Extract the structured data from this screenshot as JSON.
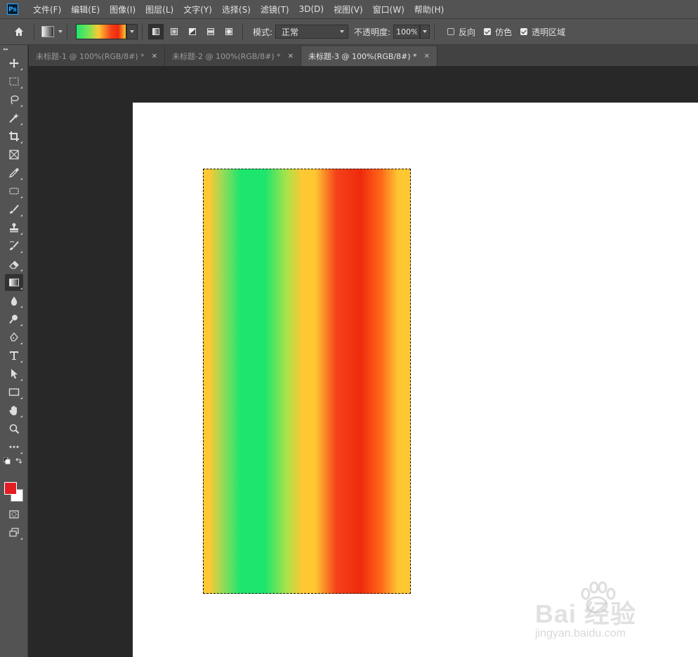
{
  "menu": {
    "logo": "Ps",
    "items": [
      "文件(F)",
      "编辑(E)",
      "图像(I)",
      "图层(L)",
      "文字(Y)",
      "选择(S)",
      "滤镜(T)",
      "3D(D)",
      "视图(V)",
      "窗口(W)",
      "帮助(H)"
    ]
  },
  "options": {
    "mode_label": "模式:",
    "mode_value": "正常",
    "opacity_label": "不透明度:",
    "opacity_value": "100%",
    "reverse_label": "反向",
    "reverse_checked": false,
    "dither_label": "仿色",
    "dither_checked": true,
    "transparency_label": "透明区域",
    "transparency_checked": true
  },
  "tabs": [
    {
      "title": "未标题-1 @ 100%(RGB/8#) *",
      "active": false
    },
    {
      "title": "未标题-2 @ 100%(RGB/8#) *",
      "active": false
    },
    {
      "title": "未标题-3 @ 100%(RGB/8#) *",
      "active": true
    }
  ],
  "colors": {
    "foreground": "#e21d24",
    "background": "#ffffff",
    "gradient_stops": [
      "#ffc832",
      "#1ee56e",
      "#1ee56e",
      "#ffc832",
      "#ee2a0c",
      "#ffc832"
    ]
  },
  "watermark": {
    "brand": "Bai 经验",
    "url": "jingyan.baidu.com"
  }
}
